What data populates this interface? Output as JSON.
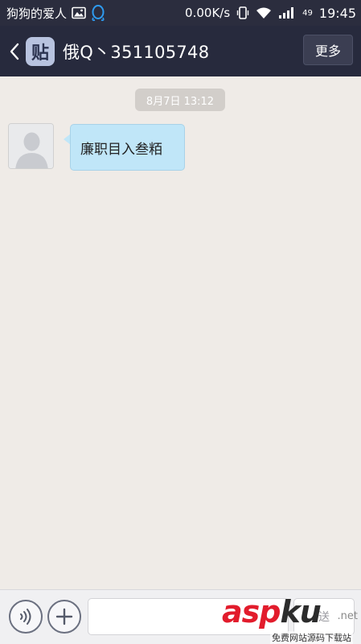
{
  "status_bar": {
    "app_name": "狗狗的爱人",
    "image_icon": "image-icon",
    "qq_icon": "qq-penguin-icon",
    "network_speed": "0.00K/s",
    "vibrate_icon": "vibrate-icon",
    "wifi_icon": "wifi-icon",
    "signal_icon": "signal-icon",
    "signal_num": "49",
    "time": "19:45"
  },
  "title_bar": {
    "back_icon": "chevron-left-icon",
    "logo_text": "贴",
    "title": "俄Q丶351105748",
    "more_label": "更多"
  },
  "chat": {
    "timestamp": "8月7日 13:12",
    "messages": [
      {
        "text": "廉职目入叁粨",
        "avatar_icon": "default-avatar-icon"
      }
    ]
  },
  "input_bar": {
    "voice_icon": "voice-icon",
    "plus_icon": "plus-icon",
    "input_value": "",
    "send_label": "送"
  },
  "watermark": {
    "main_asp": "asp",
    "main_ku": "ku",
    "net": ".net",
    "sub": "免费网站源码下载站"
  },
  "colors": {
    "status_bar_bg": "#2b2d3e",
    "title_bar_bg": "#272a3d",
    "chat_bg": "#efebe7",
    "bubble_bg": "#c0e6f8",
    "watermark_red": "#e21c2c"
  }
}
